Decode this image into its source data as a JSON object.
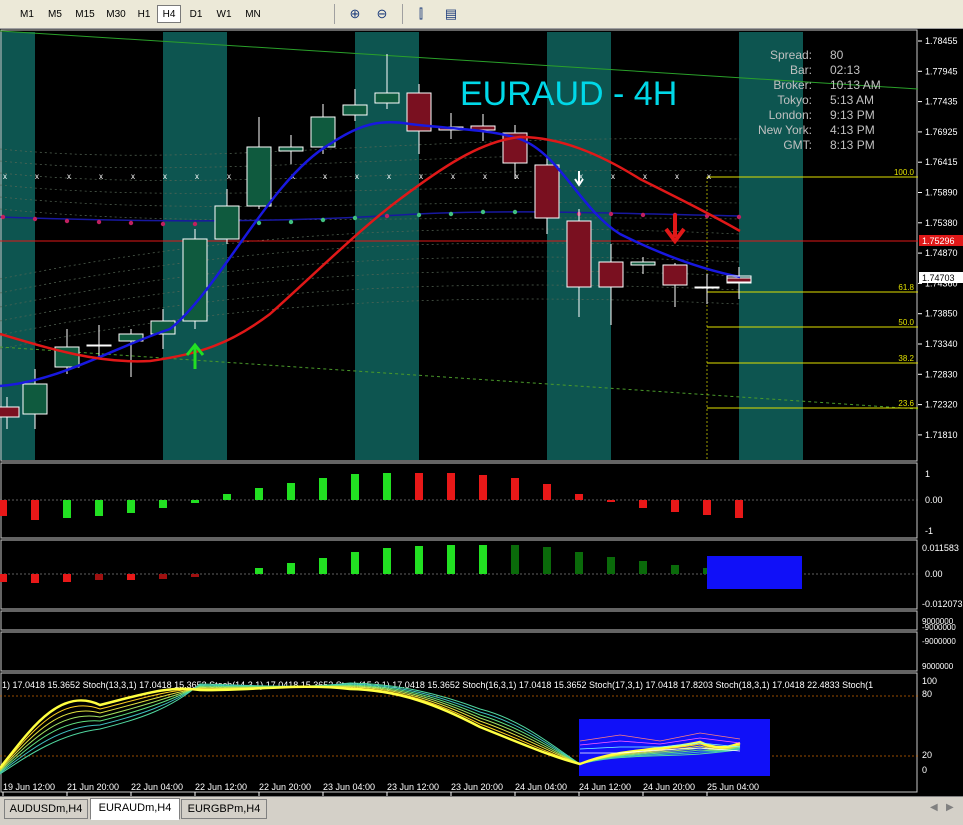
{
  "toolbar": {
    "timeframes": [
      "M1",
      "M5",
      "M15",
      "M30",
      "H1",
      "H4",
      "D1",
      "W1",
      "MN"
    ],
    "active_timeframe": "H4",
    "tools": [
      {
        "name": "zoom-in-icon",
        "glyph": "⊕"
      },
      {
        "name": "zoom-out-icon",
        "glyph": "⊖"
      },
      {
        "name": "chart-type-icon",
        "glyph": "⫿"
      },
      {
        "name": "templates-icon",
        "glyph": "▤"
      }
    ]
  },
  "chart": {
    "symbol_title": "EURAUD - 4H",
    "info_panel": [
      {
        "label": "Spread:",
        "value": "80"
      },
      {
        "label": "Bar:",
        "value": "02:13"
      },
      {
        "label": "Broker:",
        "value": "10:13 AM"
      },
      {
        "label": "Tokyo:",
        "value": "5:13 AM"
      },
      {
        "label": "London:",
        "value": "9:13 PM"
      },
      {
        "label": "New York:",
        "value": "4:13 PM"
      },
      {
        "label": "GMT:",
        "value": "8:13 PM"
      }
    ],
    "price_axis": [
      "1.78455",
      "1.77945",
      "1.77435",
      "1.76925",
      "1.76415",
      "1.75890",
      "1.75380",
      "1.74870",
      "1.74360",
      "1.73850",
      "1.73340",
      "1.72830",
      "1.72320",
      "1.71810"
    ],
    "current_price_label": "1.74703",
    "red_line_label": "1.75296",
    "fib_levels": [
      "100.0",
      "61.8",
      "50.0",
      "38.2",
      "23.6"
    ],
    "time_axis": [
      "19 Jun 12:00",
      "21 Jun 20:00",
      "22 Jun 04:00",
      "22 Jun 12:00",
      "22 Jun 20:00",
      "23 Jun 04:00",
      "23 Jun 12:00",
      "23 Jun 20:00",
      "24 Jun 04:00",
      "24 Jun 12:00",
      "24 Jun 20:00",
      "25 Jun 04:00"
    ],
    "ind1_axis": [
      "1",
      "0.00",
      "-1"
    ],
    "ind2_axis": [
      "0.011583",
      "0.00",
      "-0.012073"
    ],
    "ind3_axis": [
      "9000000",
      "-9000000"
    ],
    "ind4_axis": [
      "-9000000",
      "9000000"
    ],
    "stoch_axis": [
      "100",
      "80",
      "20",
      "0"
    ],
    "stoch_label": "1) 17.0418 15.3652  Stoch(13,3,1) 17.0418 15.3652  Stoch(14,3,1) 17.0418 15.3652  Stoch(15,3,1) 17.0418 15.3652  Stoch(16,3,1) 17.0418 15.3652  Stoch(17,3,1) 17.0418 17.8203  Stoch(18,3,1) 17.0418 22.4833  Stoch(1"
  },
  "colors": {
    "bull": "#0f5a3e",
    "bear": "#7a1020",
    "band": "#0d5550",
    "blue_ma": "#1818e0",
    "red_ma": "#e01818",
    "title": "#00d8e8",
    "fib": "#e0e000",
    "hist_green": "#22e022",
    "hist_red": "#e81818",
    "hist_dark": "#0a6a0a",
    "box": "#1010f8"
  },
  "tabs": [
    {
      "label": "AUDUSDm,H4",
      "active": false
    },
    {
      "label": "EURAUDm,H4",
      "active": true
    },
    {
      "label": "EURGBPm,H4",
      "active": false
    }
  ]
}
